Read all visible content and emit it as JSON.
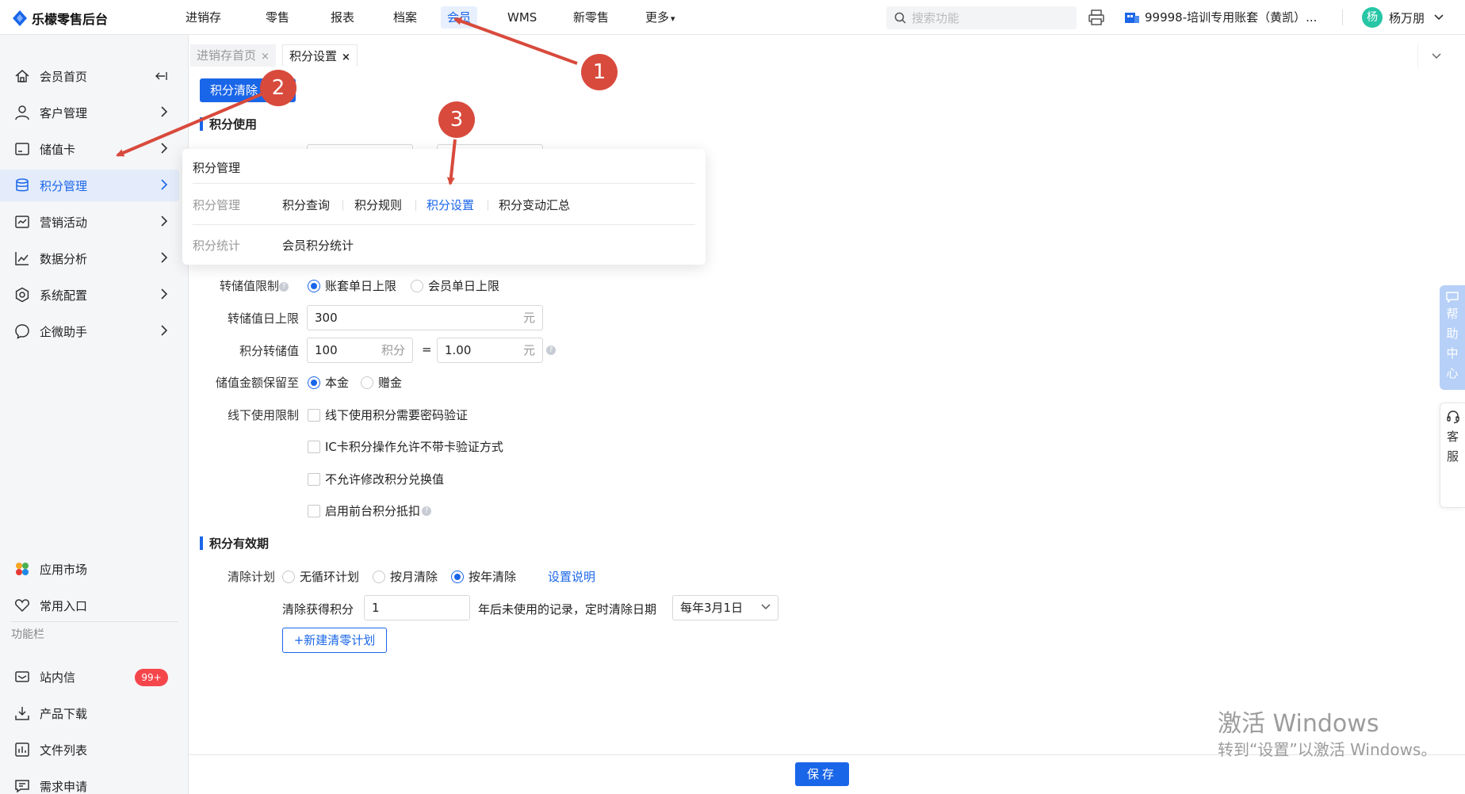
{
  "app": {
    "title": "乐檬零售后台"
  },
  "topnav": [
    "进销存",
    "零售",
    "报表",
    "档案",
    "会员",
    "WMS",
    "新零售",
    "更多"
  ],
  "topnav_more_suffix": "▾",
  "search": {
    "placeholder": "搜索功能"
  },
  "account": {
    "label": "99998-培训专用账套（黄凯）..."
  },
  "user": {
    "avatar": "杨",
    "name": "杨万朋"
  },
  "sidebar": {
    "items": [
      {
        "label": "会员首页",
        "icon": "home-icon"
      },
      {
        "label": "客户管理",
        "icon": "user-icon"
      },
      {
        "label": "储值卡",
        "icon": "card-icon"
      },
      {
        "label": "积分管理",
        "icon": "database-icon"
      },
      {
        "label": "营销活动",
        "icon": "chart-icon"
      },
      {
        "label": "数据分析",
        "icon": "line-chart-icon"
      },
      {
        "label": "系统配置",
        "icon": "settings-icon"
      },
      {
        "label": "企微助手",
        "icon": "chat-icon"
      }
    ],
    "bottom_items": [
      {
        "label": "应用市场",
        "icon": "apps-icon"
      },
      {
        "label": "常用入口",
        "icon": "heart-icon"
      }
    ],
    "group_label": "功能栏",
    "tool_items": [
      {
        "label": "站内信",
        "icon": "mail-icon",
        "badge": "99+"
      },
      {
        "label": "产品下载",
        "icon": "download-icon"
      },
      {
        "label": "文件列表",
        "icon": "file-icon"
      },
      {
        "label": "需求申请",
        "icon": "message-icon"
      }
    ]
  },
  "tabs": [
    {
      "label": "进销存首页",
      "close": "×"
    },
    {
      "label": "积分设置",
      "close": "×"
    }
  ],
  "main": {
    "clear_button": "积分清除",
    "section_use": "积分使用",
    "section_validity": "积分有效期",
    "transfer_limit_label": "转储值限制",
    "transfer_limit_options": [
      "账套单日上限",
      "会员单日上限"
    ],
    "transfer_daily_label": "转储值日上限",
    "transfer_daily_value": "300",
    "unit_yuan": "元",
    "unit_points": "积分",
    "points_convert_label": "积分转储值",
    "points_convert_points": "100",
    "points_convert_equals": "=",
    "points_convert_yuan": "1.00",
    "stored_keep_label": "储值金额保留至",
    "stored_keep_options": [
      "本金",
      "赠金"
    ],
    "offline_limit_label": "线下使用限制",
    "offline_options": [
      "线下使用积分需要密码验证",
      "IC卡积分操作允许不带卡验证方式",
      "不允许修改积分兑换值",
      "启用前台积分抵扣"
    ],
    "clear_plan_label": "清除计划",
    "clear_plan_options": [
      "无循环计划",
      "按月清除",
      "按年清除"
    ],
    "settings_help_link": "设置说明",
    "clear_points_label": "清除获得积分",
    "clear_points_value": "1",
    "clear_points_suffix": "年后未使用的记录，定时清除日期",
    "clear_date_value": "每年3月1日",
    "add_plan_button": "+新建清零计划",
    "save_button": "保存"
  },
  "menu_panel": {
    "title": "积分管理",
    "rows": [
      {
        "label": "积分管理",
        "links": [
          "积分查询",
          "积分规则",
          "积分设置",
          "积分变动汇总"
        ]
      },
      {
        "label": "积分统计",
        "links": [
          "会员积分统计"
        ]
      }
    ]
  },
  "help_float": "帮助中心",
  "service_float": "客服",
  "windows": {
    "title": "激活 Windows",
    "subtitle": "转到“设置”以激活 Windows。"
  },
  "markers": [
    "1",
    "2",
    "3"
  ],
  "colors": {
    "accent": "#1a66e8",
    "annotation": "#d84a3c",
    "badge": "#f5464c"
  }
}
